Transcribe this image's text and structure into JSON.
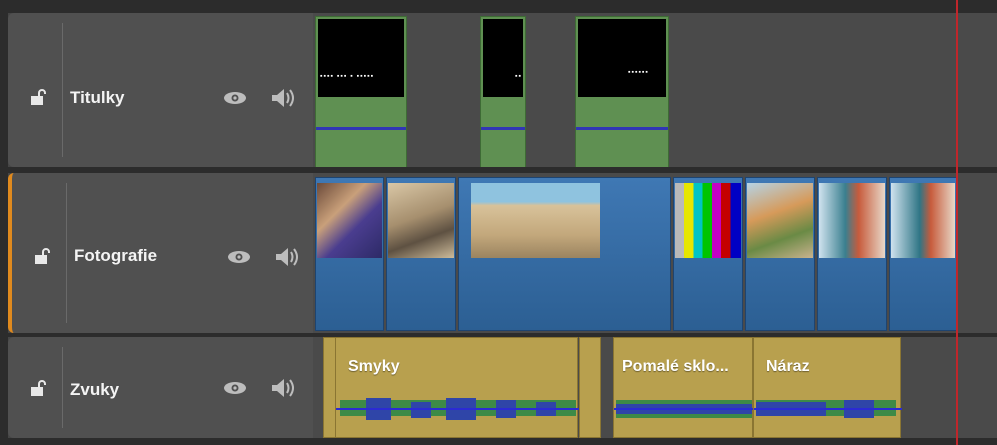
{
  "tracks": [
    {
      "name": "Titulky",
      "locked": false,
      "visible": true,
      "audio": true
    },
    {
      "name": "Fotografie",
      "locked": false,
      "visible": true,
      "audio": true,
      "active": true
    },
    {
      "name": "Zvuky",
      "locked": false,
      "visible": true,
      "audio": true
    }
  ],
  "audio_clips": [
    "Smyky",
    "Pomalé sklo...",
    "Náraz"
  ],
  "colors": {
    "title_clip": "#5f9052",
    "photo_clip": "#3f78b4",
    "audio_clip": "#b8a04e",
    "playhead": "#c0262b",
    "active_track": "#e08a1e"
  }
}
